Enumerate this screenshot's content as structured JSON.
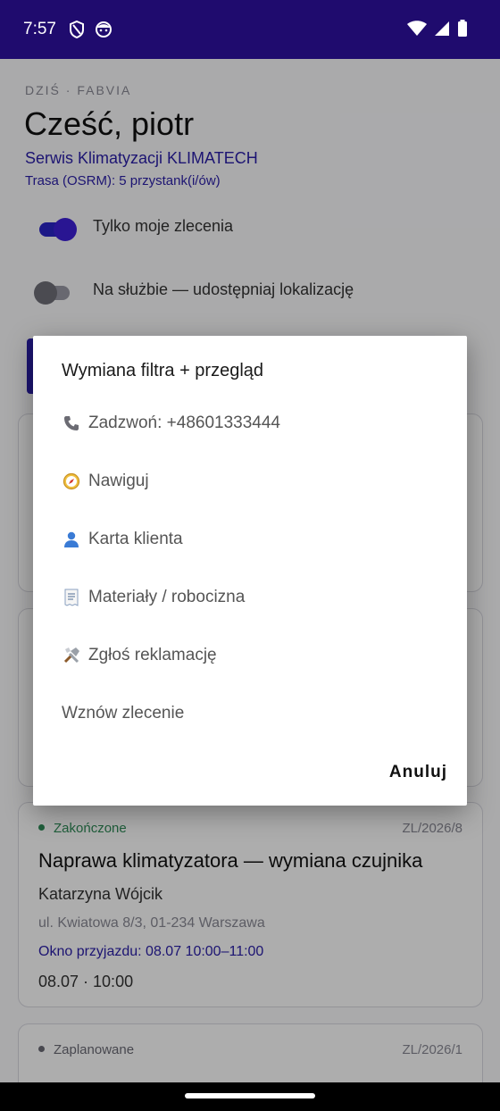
{
  "status_bar": {
    "time": "7:57"
  },
  "header": {
    "kicker": "DZIŚ · FABVIA",
    "greeting": "Cześć, piotr",
    "company": "Serwis Klimatyzacji KLIMATECH",
    "route": "Trasa (OSRM): 5 przystank(i/ów)"
  },
  "toggles": [
    {
      "label": "Tylko moje zlecenia",
      "state": "on"
    },
    {
      "label": "Na służbie — udostępniaj lokalizację",
      "state": "off"
    }
  ],
  "cards": [
    {
      "status": "Zakończone",
      "status_color": "#2e8b57",
      "code": "ZL/2026/8",
      "title": "Naprawa klimatyzatora — wymiana czujnika",
      "client": "Katarzyna Wójcik",
      "address": "ul. Kwiatowa 8/3, 01-234 Warszawa",
      "window": "Okno przyjazdu: 08.07 10:00–11:00",
      "datetime": "08.07 · 10:00"
    },
    {
      "status": "Zaplanowane",
      "status_color": "#6a6a75",
      "code": "ZL/2026/1"
    }
  ],
  "dialog": {
    "title": "Wymiana filtra + przegląd",
    "items": [
      {
        "icon": "phone-icon",
        "label": "Zadzwoń: +48601333444"
      },
      {
        "icon": "compass-icon",
        "label": "Nawiguj"
      },
      {
        "icon": "person-icon",
        "label": "Karta klienta"
      },
      {
        "icon": "receipt-icon",
        "label": "Materiały / robocizna"
      },
      {
        "icon": "tools-icon",
        "label": "Zgłoś reklamację"
      },
      {
        "icon": "",
        "label": "Wznów zlecenie"
      }
    ],
    "cancel_label": "Anuluj"
  },
  "colors": {
    "status_bar": "#1f0b6e",
    "accent": "#2a1ea8"
  }
}
